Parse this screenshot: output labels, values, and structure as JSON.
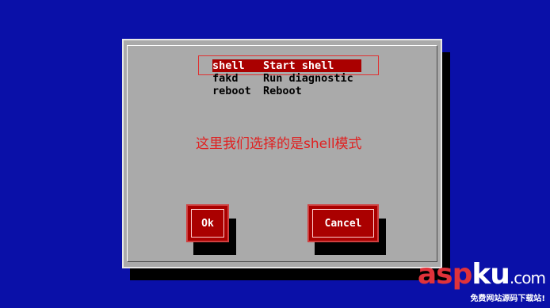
{
  "menu": {
    "items": [
      {
        "key": "shell",
        "label": "Start shell",
        "selected": true
      },
      {
        "key": "fakd",
        "label": "Run diagnostic",
        "selected": false
      },
      {
        "key": "reboot",
        "label": "Reboot",
        "selected": false
      }
    ]
  },
  "annotation": "这里我们选择的是shell模式",
  "buttons": {
    "ok": "Ok",
    "cancel": "Cancel"
  },
  "watermark": {
    "brand_red": "asp",
    "brand_white": "ku",
    "tld": ".com",
    "tagline": "免费网站源码下载站!"
  },
  "colors": {
    "background": "#0a10a8",
    "dialog": "#aaaaaa",
    "accent": "#aa0000",
    "annotation": "#e02020"
  }
}
